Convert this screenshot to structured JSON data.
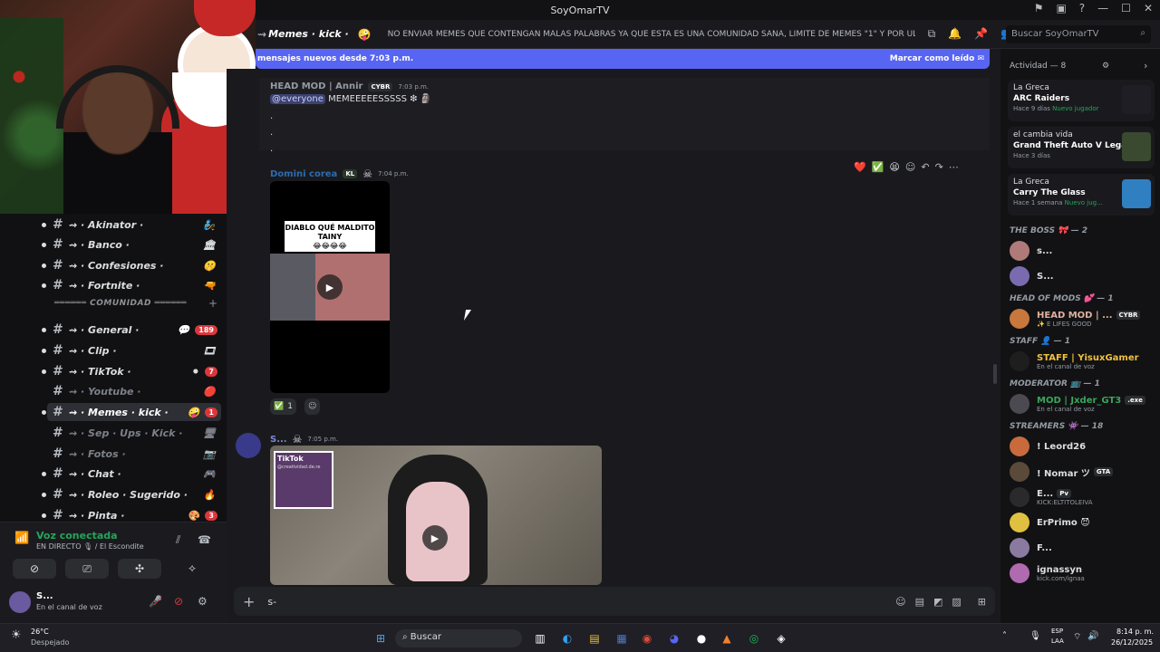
{
  "window": {
    "title": "SoyOmarTV"
  },
  "channels": [
    {
      "label": "⇝ · Akinator ·",
      "emoji": "🧞",
      "muted": false
    },
    {
      "label": "⇝ · Banco ·",
      "emoji": "🏛",
      "muted": false
    },
    {
      "label": "⇝ · Confesiones ·",
      "emoji": "🤫",
      "muted": false
    },
    {
      "label": "⇝ · Fortnite ·",
      "emoji": "🔫",
      "muted": false
    },
    {
      "label": "⇝ · General ·",
      "emoji": "💬",
      "muted": false,
      "badge": "189"
    },
    {
      "label": "⇝ · Clip ·",
      "emoji": "🎞",
      "muted": false
    },
    {
      "label": "⇝ · TikTok ·",
      "emoji": "⚫",
      "muted": false,
      "badge": "7"
    },
    {
      "label": "⇝ · Youtube ·",
      "emoji": "🔴",
      "muted": true
    },
    {
      "label": "⇝ · Memes · kick ·",
      "emoji": "🤪",
      "muted": false,
      "badge": "1",
      "active": true
    },
    {
      "label": "⇝ · Sep · Ups · Kick ·",
      "emoji": "🖥",
      "muted": true
    },
    {
      "label": "⇝ · Fotos ·",
      "emoji": "📷",
      "muted": true
    },
    {
      "label": "⇝ · Chat ·",
      "emoji": "🎮",
      "muted": false
    },
    {
      "label": "⇝ · Roleo · Sugerido ·",
      "emoji": "🔥",
      "muted": false
    },
    {
      "label": "⇝ · Pinta ·",
      "emoji": "🎨",
      "muted": false,
      "badge": "3"
    }
  ],
  "category": {
    "label": "══════ COMUNIDAD ══════"
  },
  "voice": {
    "status": "Voz conectada",
    "location": "EN DIRECTO 🎙 / El Escondite",
    "user_name": "S...",
    "user_status": "En el canal de voz"
  },
  "header": {
    "channel_name": "Memes · kick ·",
    "topic": "NO ENVIAR MEMES QUE CONTENGAN MALAS PALABRAS YA QUE ESTA ES UNA COMUNIDAD SANA, LIMITE DE MEMES \"1\" Y POR ULTIMO E...",
    "search_placeholder": "Buscar SoyOmarTV"
  },
  "banner": {
    "text": "mensajes nuevos desde 7:03 p.m.",
    "action": "Marcar como leído"
  },
  "messages": [
    {
      "author": "HEAD MOD | Annir",
      "tag": "CYBR",
      "time": "7:03 p.m.",
      "mention": "@everyone",
      "text": "MEMEEEEESSSSS",
      "lines": [
        ".",
        ".",
        "."
      ]
    },
    {
      "author": "Domini corea",
      "tag": "KL",
      "time": "7:04 p.m.",
      "video_caption": "DIABLO QUÉ MALDITO TAINY",
      "video_caption_emoji": "😂😂😂😂",
      "reaction_count": "1"
    },
    {
      "author": "S...",
      "time": "7:05 p.m.",
      "overlay_brand": "TikTok",
      "overlay_handle": "@creatividad.de.re"
    }
  ],
  "composer": {
    "value": "s-"
  },
  "right": {
    "activity_title": "Actividad — 8",
    "activities": [
      {
        "who": "La Greca",
        "game": "ARC Raiders",
        "meta1": "Hace 9 días",
        "meta2": "Nuevo jugador",
        "color": "#1e1e24"
      },
      {
        "who": "el cambia vida",
        "game": "Grand Theft Auto V Legacy",
        "meta1": "Hace 3 días",
        "meta2": "",
        "color": "#3a4a30"
      },
      {
        "who": "La Greca",
        "game": "Carry The Glass",
        "meta1": "Hace 1 semana",
        "meta2": "Nuevo jug...",
        "color": "#2f7fc1"
      }
    ],
    "groups": [
      {
        "title": "THE BOSS 🎀 — 2",
        "members": [
          {
            "name": "s...",
            "sub": "",
            "color": "#dbdee1",
            "av": "#b07a7a"
          },
          {
            "name": "S...",
            "sub": "",
            "color": "#dbdee1",
            "av": "#7a6ab0"
          }
        ]
      },
      {
        "title": "HEAD OF MODS 💕 — 1",
        "members": [
          {
            "name": "HEAD MOD | ...",
            "sub": "✨ E LIFES GOOD",
            "color": "#e0b0a0",
            "av": "#c8783c",
            "tag": "CYBR"
          }
        ]
      },
      {
        "title": "STAFF 👤 — 1",
        "members": [
          {
            "name": "STAFF | YisuxGamer",
            "sub": "En el canal de voz",
            "color": "#f0c040",
            "av": "#1e1e1e"
          }
        ]
      },
      {
        "title": "MODERATOR 📺 — 1",
        "members": [
          {
            "name": "MOD | Jxder_GT3",
            "sub": "En el canal de voz",
            "color": "#3ba55c",
            "av": "#4a4a50",
            "tag": ".exe"
          }
        ]
      },
      {
        "title": "STREAMERS 👾 — 18",
        "members": [
          {
            "name": "! Leord26",
            "sub": "",
            "color": "#dbdee1",
            "av": "#c86a3c"
          },
          {
            "name": "! Nomar ツ",
            "sub": "",
            "color": "#dbdee1",
            "av": "#5a4a3a",
            "tag": "GTA"
          },
          {
            "name": "E...",
            "sub": "KICK:ELTITOLEIVA",
            "color": "#dbdee1",
            "av": "#2a2a2a",
            "tag": "Pv"
          },
          {
            "name": "ErPrimo 😈",
            "sub": "",
            "color": "#dbdee1",
            "av": "#e0c040"
          },
          {
            "name": "F...",
            "sub": "",
            "color": "#dbdee1",
            "av": "#8a7aa0"
          },
          {
            "name": "ignassyn",
            "sub": "kick.com/ignaa",
            "color": "#dbdee1",
            "av": "#b06ab0"
          }
        ]
      }
    ]
  },
  "taskbar": {
    "weather_temp": "26°C",
    "weather_desc": "Despejado",
    "search_label": "Buscar",
    "lang1": "ESP",
    "lang2": "LAA",
    "time": "8:14 p. m.",
    "date": "26/12/2025"
  }
}
